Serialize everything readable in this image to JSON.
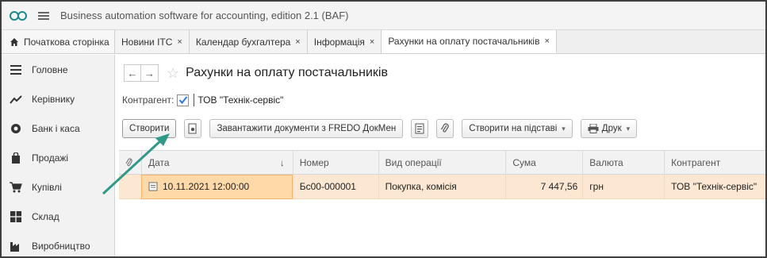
{
  "app": {
    "title": "Business automation software for accounting, edition 2.1 (BAF)"
  },
  "tabs": {
    "home_label": "Початкова сторінка",
    "items": [
      {
        "label": "Новини ІТС",
        "close": "×"
      },
      {
        "label": "Календар бухгалтера",
        "close": "×"
      },
      {
        "label": "Інформація",
        "close": "×"
      },
      {
        "label": "Рахунки на оплату постачальників",
        "close": "×"
      }
    ]
  },
  "sidebar": {
    "items": [
      {
        "label": "Головне",
        "icon": "menu-lines-icon"
      },
      {
        "label": "Керівнику",
        "icon": "trend-chart-icon"
      },
      {
        "label": "Банк і каса",
        "icon": "bank-coin-icon"
      },
      {
        "label": "Продажі",
        "icon": "shopping-bag-icon"
      },
      {
        "label": "Купівлі",
        "icon": "shopping-cart-icon"
      },
      {
        "label": "Склад",
        "icon": "warehouse-grid-icon"
      },
      {
        "label": "Виробництво",
        "icon": "factory-icon"
      }
    ]
  },
  "page": {
    "title": "Рахунки на оплату постачальників",
    "back_glyph": "←",
    "forward_glyph": "→",
    "star_glyph": "☆"
  },
  "filter": {
    "label": "Контрагент:",
    "checked": true,
    "value": "ТОВ \"Технік-сервіс\""
  },
  "toolbar": {
    "create": "Створити",
    "load_fredo": "Завантажити документи з FREDO ДокМен",
    "create_based": "Створити на підставі",
    "print": "Друк"
  },
  "table": {
    "columns": [
      "Дата",
      "Номер",
      "Вид операції",
      "Сума",
      "Валюта",
      "Контрагент"
    ],
    "sort_indicator": "↓",
    "rows": [
      {
        "date": "10.11.2021 12:00:00",
        "number": "Бс00-000001",
        "operation": "Покупка, комісія",
        "sum": "7 447,56",
        "currency": "грн",
        "counterparty": "ТОВ \"Технік-сервіс\""
      }
    ]
  },
  "colors": {
    "selected_row": "#fbe7d2",
    "selected_cell": "#ffd9a8",
    "arrow": "#2f9a8a",
    "logo": "#1a8a8a"
  }
}
